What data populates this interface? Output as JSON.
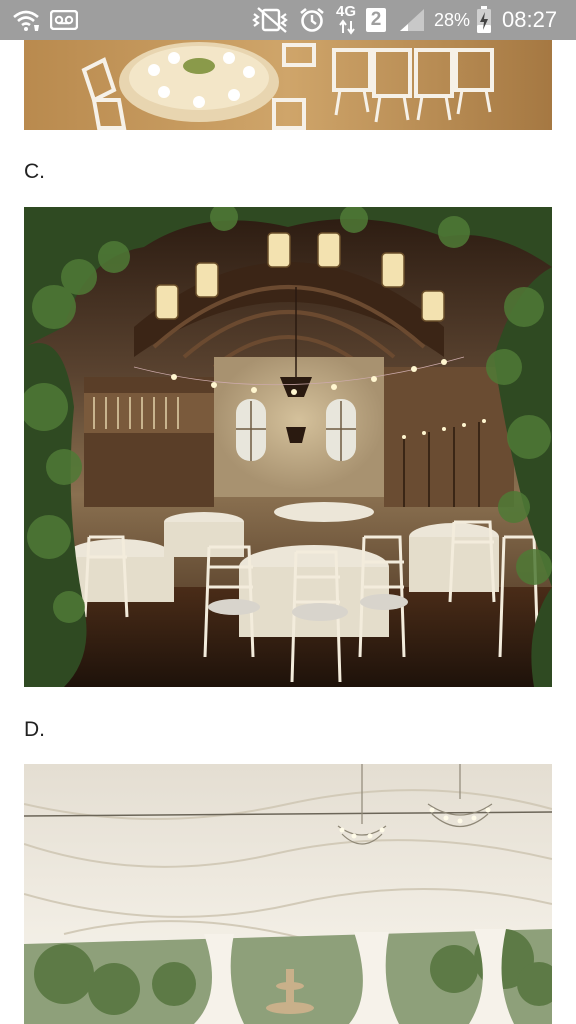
{
  "status_bar": {
    "time": "08:27",
    "battery_percent": "28%",
    "network": "4G",
    "sim_slot": "2",
    "icons": [
      "wifi-calling-icon",
      "voicemail-icon",
      "mute-vibrate-icon",
      "alarm-icon",
      "signal-icon",
      "battery-charging-icon"
    ],
    "background": "#9e9e9e"
  },
  "content": {
    "options": [
      {
        "label": "C.",
        "photo": "venue-photo-c-castle-hall"
      },
      {
        "label": "D.",
        "photo": "venue-photo-d-tent"
      }
    ],
    "previous_photo": "venue-photo-b-white-chairs"
  },
  "colors": {
    "text": "#222222",
    "page": "#ffffff"
  }
}
